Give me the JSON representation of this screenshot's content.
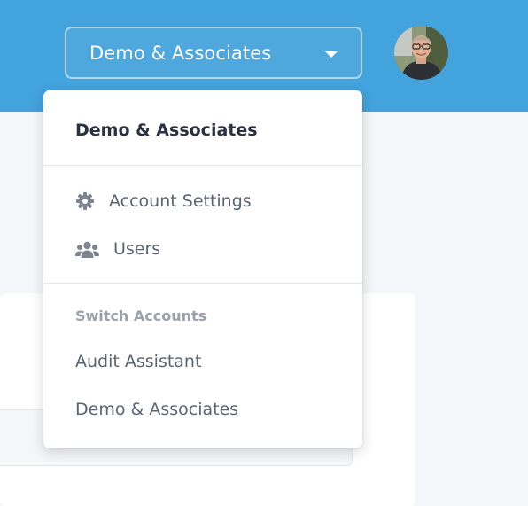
{
  "header": {
    "account_switcher_label": "Demo & Associates",
    "accent_color": "#43a3dc"
  },
  "dropdown": {
    "current_account": "Demo & Associates",
    "items": [
      {
        "label": "Account Settings",
        "icon": "gear-icon"
      },
      {
        "label": "Users",
        "icon": "users-icon"
      }
    ],
    "switch_section_label": "Switch Accounts",
    "accounts": [
      {
        "label": "Audit Assistant"
      },
      {
        "label": "Demo & Associates"
      }
    ]
  },
  "user": {
    "avatar": "user-avatar"
  }
}
